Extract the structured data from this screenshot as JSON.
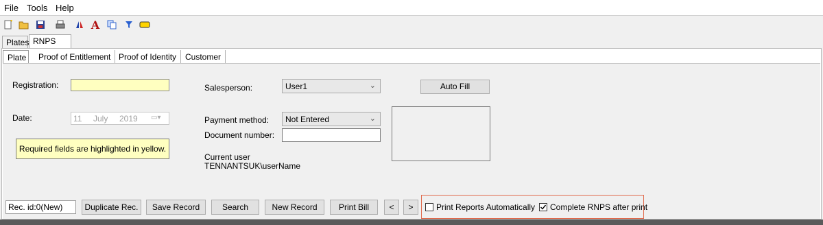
{
  "menu": {
    "file": "File",
    "tools": "Tools",
    "help": "Help"
  },
  "toolbar_icons": [
    "new-document-icon",
    "open-folder-icon",
    "save-icon",
    "print-icon",
    "printer-setup-icon",
    "font-icon",
    "copy-icon",
    "filter-icon",
    "label-icon"
  ],
  "tabs": {
    "plates": "Plates",
    "rnps_log": "RNPS Log"
  },
  "subtabs": {
    "plate": "Plate",
    "proof_entitlement": "Proof of Entitlement",
    "proof_identity": "Proof of Identity",
    "customer": "Customer"
  },
  "form": {
    "registration_label": "Registration:",
    "registration_value": "",
    "date_label": "Date:",
    "date_day": "11",
    "date_month": "July",
    "date_year": "2019",
    "required_note": "Required fields are highlighted in yellow.",
    "salesperson_label": "Salesperson:",
    "salesperson_value": "User1",
    "payment_label": "Payment method:",
    "payment_value": "Not Entered",
    "docnum_label": "Document number:",
    "docnum_value": "",
    "current_user_label": "Current user",
    "current_user_value": "TENNANTSUK\\userName",
    "auto_fill": "Auto Fill"
  },
  "bottom": {
    "rec_id": "Rec. id:0(New)",
    "duplicate": "Duplicate Rec.",
    "save": "Save Record",
    "search": "Search",
    "new": "New Record",
    "print_bill": "Print Bill",
    "prev": "<",
    "next": ">",
    "print_reports": "Print Reports Automatically",
    "print_reports_checked": false,
    "complete_rnps": "Complete RNPS after print",
    "complete_rnps_checked": true
  },
  "colors": {
    "required": "#ffffc0",
    "highlight_border": "#e0684a"
  }
}
